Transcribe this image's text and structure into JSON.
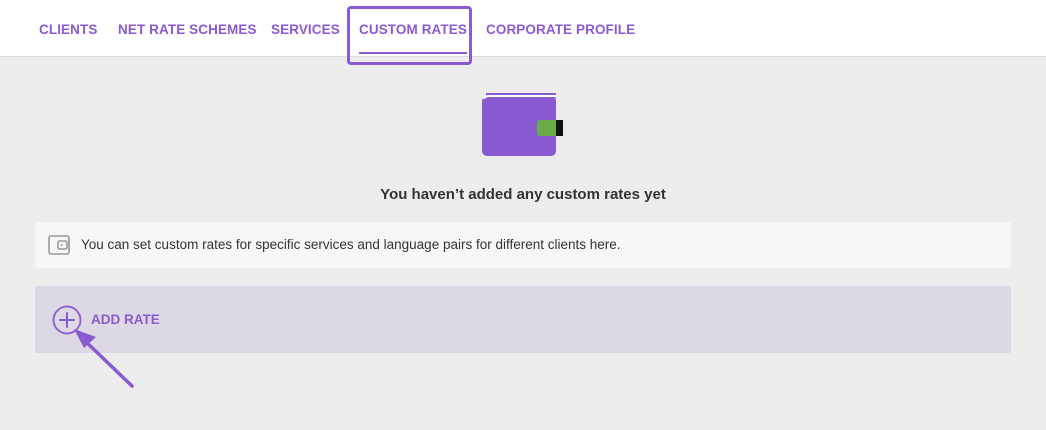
{
  "colors": {
    "accent": "#8a5ad3",
    "tab_text": "#8a5ad3",
    "title_text": "#333333",
    "body_text": "#333333",
    "wallet_green": "#6aab47",
    "wallet_clasp": "#111111",
    "info_icon": "#9a9a9a"
  },
  "nav": {
    "tabs": [
      {
        "label": "CLIENTS"
      },
      {
        "label": "NET RATE SCHEMES"
      },
      {
        "label": "SERVICES"
      },
      {
        "label": "CUSTOM RATES"
      },
      {
        "label": "CORPORATE PROFILE"
      }
    ]
  },
  "empty_state": {
    "icon": "wallet-icon",
    "title": "You haven’t added any custom rates yet"
  },
  "info": {
    "icon": "wallet-outline-icon",
    "text": "You can set custom rates for specific services and language pairs for different clients here."
  },
  "add": {
    "icon": "plus-circle-icon",
    "label": "ADD RATE"
  },
  "annotation": {
    "icon": "arrow-icon"
  }
}
